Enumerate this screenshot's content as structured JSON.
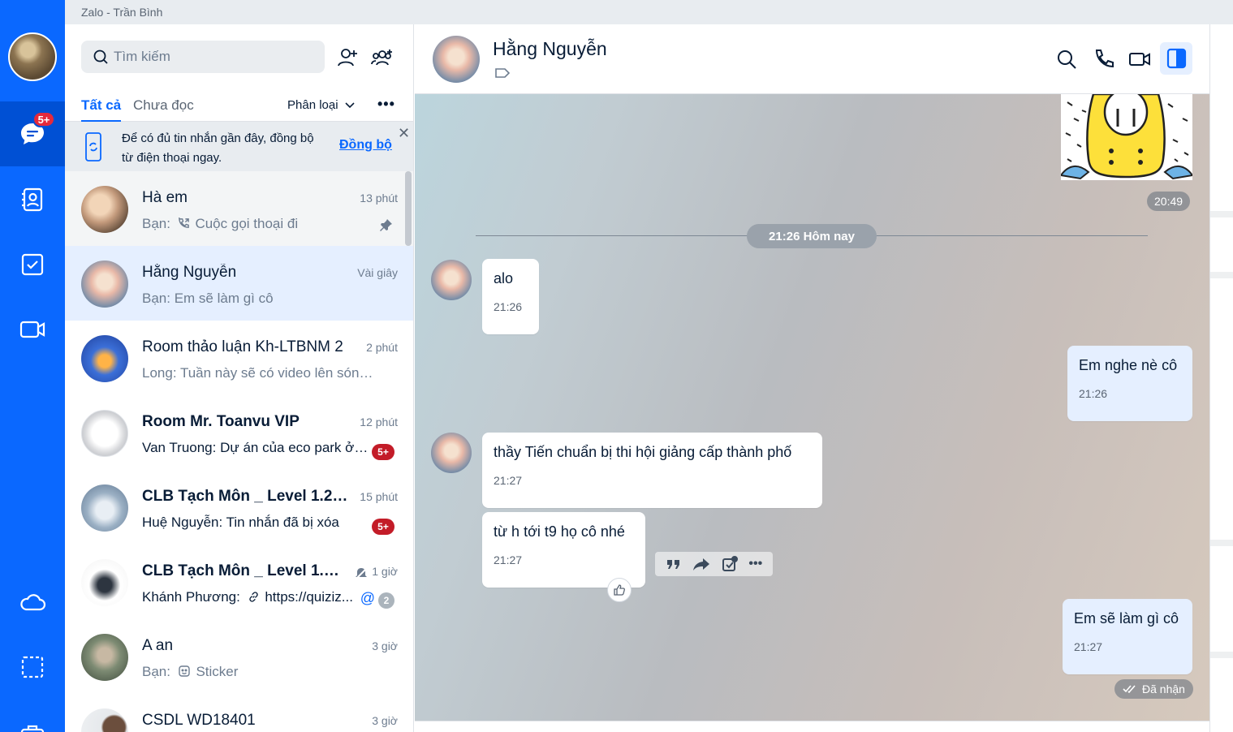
{
  "window": {
    "title": "Zalo - Trần Bình"
  },
  "nav": {
    "messages_badge": "5+"
  },
  "search": {
    "placeholder": "Tìm kiếm"
  },
  "tabs": {
    "all": "Tất cả",
    "unread": "Chưa đọc",
    "classify": "Phân loại"
  },
  "sync_banner": {
    "text": "Để có đủ tin nhắn gần đây, đồng bộ từ điện thoại ngay.",
    "link": "Đồng bộ"
  },
  "conversations": [
    {
      "name": "Hà em",
      "time": "13 phút",
      "prefix": "Bạn:",
      "message": "Cuộc gọi thoại đi",
      "pinned": true
    },
    {
      "name": "Hằng Nguyễn",
      "time": "Vài giây",
      "message": "Bạn: Em sẽ làm gì cô"
    },
    {
      "name": "Room thảo luận Kh-LTBNM 2",
      "time": "2 phút",
      "message": "Long: Tuần này sẽ có video lên sóng: ..."
    },
    {
      "name": "Room Mr. Toanvu VIP",
      "time": "12 phút",
      "message": "Van Truong: Dự án của eco park ở ...",
      "badge": "5+"
    },
    {
      "name": "CLB Tạch Môn _ Level 1.2 (...",
      "time": "15 phút",
      "message": "Huệ Nguyễn: Tin nhắn đã bị xóa",
      "badge": "5+"
    },
    {
      "name": "CLB Tạch Môn _ Level 1.1 (...",
      "time": "1 giờ",
      "prefix": "Khánh Phương:",
      "message": "https://quiziz...",
      "mention_count": "2"
    },
    {
      "name": "A an",
      "time": "3 giờ",
      "prefix": "Bạn:",
      "message": "Sticker"
    },
    {
      "name": "CSDL WD18401",
      "time": "3 giờ",
      "message": ""
    }
  ],
  "chat": {
    "name": "Hằng Nguyễn",
    "sticker_time": "20:49",
    "divider": "21:26 Hôm nay",
    "messages": [
      {
        "text": "alo",
        "time": "21:26"
      },
      {
        "text": "Em nghe nè cô",
        "time": "21:26"
      },
      {
        "text": "thầy Tiến chuẩn bị thi hội giảng cấp thành phố",
        "time": "21:27"
      },
      {
        "text": "từ h tới t9 họ cô nhé",
        "time": "21:27"
      },
      {
        "text": "Em sẽ làm gì cô",
        "time": "21:27"
      }
    ],
    "status": "Đã nhận"
  },
  "colors": {
    "brand": "#0a68ff",
    "rail_active": "#0050d4",
    "badge": "#c31c28",
    "mine_bubble": "#e5efff"
  }
}
